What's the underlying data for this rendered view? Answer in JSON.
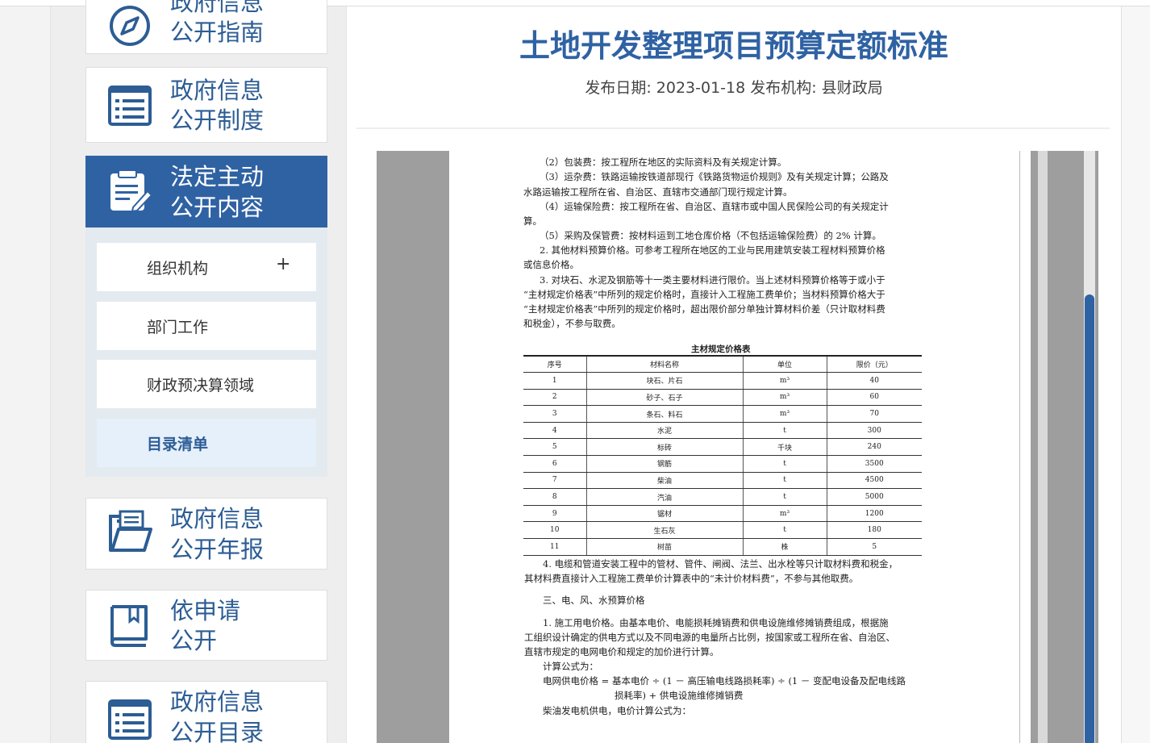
{
  "sidebar": {
    "items": [
      {
        "line1": "政府信息",
        "line2": "公开指南",
        "icon": "compass-icon"
      },
      {
        "line1": "政府信息",
        "line2": "公开制度",
        "icon": "list-document-icon"
      },
      {
        "line1": "法定主动",
        "line2": "公开内容",
        "icon": "edit-document-icon",
        "active": true
      },
      {
        "line1": "政府信息",
        "line2": "公开年报",
        "icon": "open-folder-icon"
      },
      {
        "line1": "依申请",
        "line2": "公开",
        "icon": "book-icon"
      },
      {
        "line1": "政府信息",
        "line2": "公开目录",
        "icon": "list-document-icon"
      }
    ],
    "subitems": [
      {
        "label": "组织机构",
        "expand": "+"
      },
      {
        "label": "部门工作"
      },
      {
        "label": "财政预决算领域"
      },
      {
        "label": "目录清单",
        "current": true
      }
    ]
  },
  "article": {
    "title": "土地开发整理项目预算定额标准",
    "meta": "发布日期: 2023-01-18 发布机构: 县财政局"
  },
  "document": {
    "lines": [
      "（2）包装费：按工程所在地区的实际资料及有关规定计算。",
      "（3）运杂费：铁路运输按铁道部现行《铁路货物运价规则》及有关规定计算；公路及",
      "水路运输按工程所在省、自治区、直辖市交通部门现行规定计算。",
      "（4）运输保险费：按工程所在省、自治区、直辖市或中国人民保险公司的有关规定计",
      "算。",
      "（5）采购及保管费：按材料运到工地仓库价格（不包括运输保险费）的 2% 计算。",
      "2. 其他材料预算价格。可参考工程所在地区的工业与民用建筑安装工程材料预算价格",
      "或信息价格。",
      "3. 对块石、水泥及钢筋等十一类主要材料进行限价。当上述材料预算价格等于或小于",
      "“主材规定价格表”中所列的规定价格时，直接计入工程施工费单价；当材料预算价格大于",
      "“主材规定价格表”中所列的规定价格时，超出限价部分单独计算材料价差（只计取材料费",
      "和税金），不参与取费。"
    ],
    "table_title": "主材规定价格表",
    "table_headers": [
      "序号",
      "材料名称",
      "单位",
      "限价（元）"
    ],
    "table_rows": [
      [
        "1",
        "块石、片石",
        "m³",
        "40"
      ],
      [
        "2",
        "砂子、石子",
        "m³",
        "60"
      ],
      [
        "3",
        "条石、料石",
        "m³",
        "70"
      ],
      [
        "4",
        "水泥",
        "t",
        "300"
      ],
      [
        "5",
        "标砖",
        "千块",
        "240"
      ],
      [
        "6",
        "钢筋",
        "t",
        "3500"
      ],
      [
        "7",
        "柴油",
        "t",
        "4500"
      ],
      [
        "8",
        "汽油",
        "t",
        "5000"
      ],
      [
        "9",
        "锯材",
        "m³",
        "1200"
      ],
      [
        "10",
        "生石灰",
        "t",
        "180"
      ],
      [
        "11",
        "树苗",
        "株",
        "5"
      ]
    ],
    "after_lines": [
      "4. 电缆和管道安装工程中的管材、管件、闸阀、法兰、出水栓等只计取材料费和税金，",
      "其材料费直接计入工程施工费单价计算表中的“未计价材料费”，不参与其他取费。",
      "三、电、风、水预算价格",
      "1. 施工用电价格。由基本电价、电能损耗摊销费和供电设施维修摊销费组成，根据施",
      "工组织设计确定的供电方式以及不同电源的电量所占比例，按国家或工程所在省、自治区、",
      "直辖市规定的电网电价和规定的加价进行计算。",
      "计算公式为：",
      "电网供电价格 = 基本电价 ÷ (1 － 高压输电线路损耗率) ÷ (1 － 变配电设备及配电线路",
      "损耗率) + 供电设施维修摊销费",
      "柴油发电机供电，电价计算公式为："
    ]
  },
  "colors": {
    "accent": "#2f62a3",
    "nav_text": "#2c5d94"
  }
}
